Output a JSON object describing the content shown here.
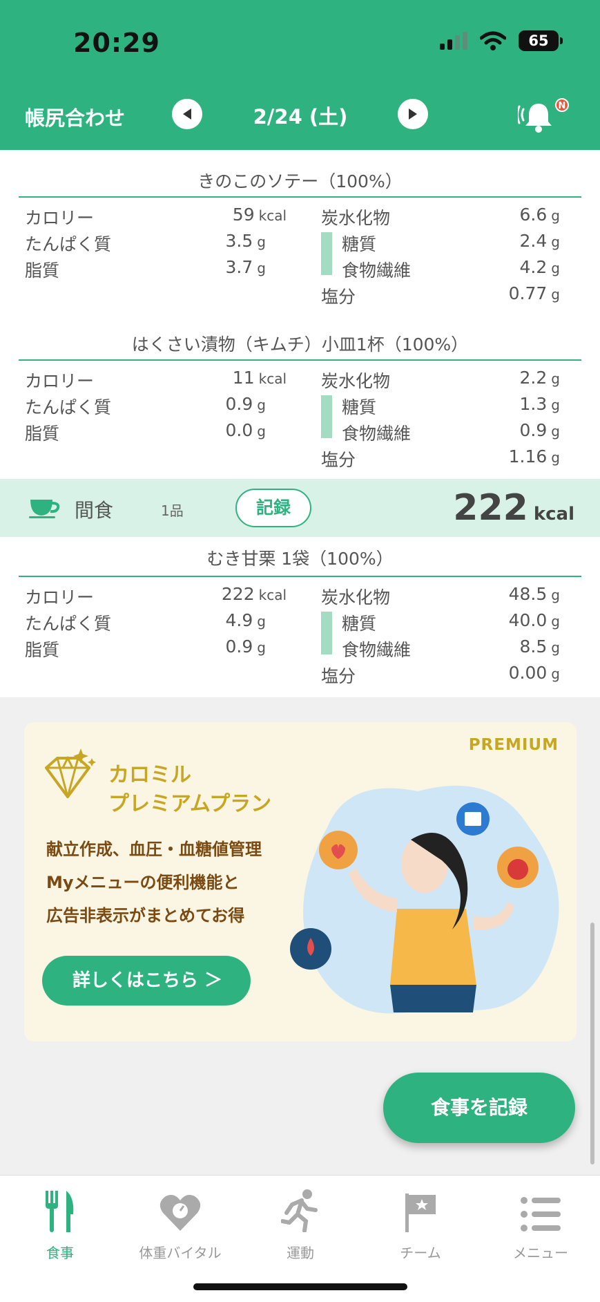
{
  "status": {
    "time": "20:29",
    "battery": "65"
  },
  "header": {
    "title": "帳尻合わせ",
    "date": "2/24 (土)",
    "badge": "N"
  },
  "foods": [
    {
      "title": "きのこのソテー（100%）",
      "calorie_label": "カロリー",
      "calorie": "59",
      "kcal_unit": "kcal",
      "protein_label": "たんぱく質",
      "protein": "3.5",
      "fat_label": "脂質",
      "fat": "3.7",
      "carb_label": "炭水化物",
      "carb": "6.6",
      "sugar_label": "糖質",
      "sugar": "2.4",
      "fiber_label": "食物繊維",
      "fiber": "4.2",
      "salt_label": "塩分",
      "salt": "0.77",
      "g_unit": "g"
    },
    {
      "title": "はくさい漬物（キムチ）小皿1杯（100%）",
      "calorie_label": "カロリー",
      "calorie": "11",
      "kcal_unit": "kcal",
      "protein_label": "たんぱく質",
      "protein": "0.9",
      "fat_label": "脂質",
      "fat": "0.0",
      "carb_label": "炭水化物",
      "carb": "2.2",
      "sugar_label": "糖質",
      "sugar": "1.3",
      "fiber_label": "食物繊維",
      "fiber": "0.9",
      "salt_label": "塩分",
      "salt": "1.16",
      "g_unit": "g"
    },
    {
      "title": "むき甘栗 1袋（100%）",
      "calorie_label": "カロリー",
      "calorie": "222",
      "kcal_unit": "kcal",
      "protein_label": "たんぱく質",
      "protein": "4.9",
      "fat_label": "脂質",
      "fat": "0.9",
      "carb_label": "炭水化物",
      "carb": "48.5",
      "sugar_label": "糖質",
      "sugar": "40.0",
      "fiber_label": "食物繊維",
      "fiber": "8.5",
      "salt_label": "塩分",
      "salt": "0.00",
      "g_unit": "g"
    }
  ],
  "snack": {
    "label": "間食",
    "count": "1品",
    "record_label": "記録",
    "kcal": "222",
    "kcal_unit": "kcal",
    "icon": "cup-icon"
  },
  "promo": {
    "tag": "PREMIUM",
    "title_line1": "カロミル",
    "title_line2": "プレミアムプラン",
    "desc_line1": "献立作成、血圧・血糖値管理",
    "desc_line2": "Myメニューの便利機能と",
    "desc_line3": "広告非表示がまとめてお得",
    "button": "詳しくはこちら ＞"
  },
  "fab": {
    "label": "食事を記録"
  },
  "tabs": [
    {
      "label": "食事",
      "icon": "fork-knife-icon",
      "active": true
    },
    {
      "label": "体重バイタル",
      "icon": "heart-scale-icon",
      "active": false
    },
    {
      "label": "運動",
      "icon": "runner-icon",
      "active": false
    },
    {
      "label": "チーム",
      "icon": "flag-icon",
      "active": false
    },
    {
      "label": "メニュー",
      "icon": "list-icon",
      "active": false
    }
  ],
  "colors": {
    "accent": "#2eb380",
    "snack_bg": "#d9f2e8",
    "gold": "#c7a624"
  }
}
